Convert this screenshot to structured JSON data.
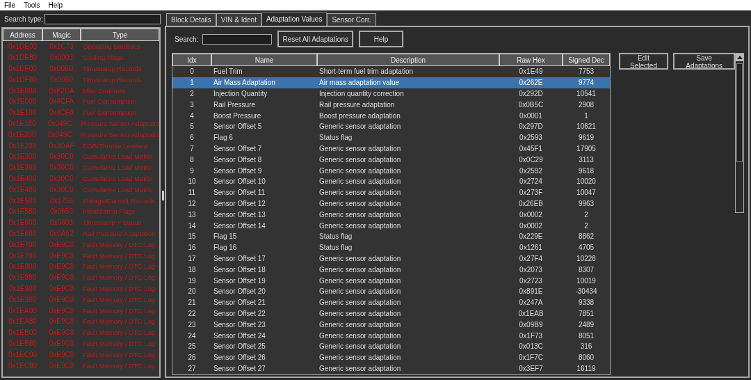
{
  "menu": [
    "File",
    "Tools",
    "Help"
  ],
  "search_type": {
    "label": "Search type:"
  },
  "blocks": {
    "columns": [
      "Address",
      "Magic",
      "Type"
    ],
    "rows": [
      {
        "address": "0x1DE00",
        "magic": "0x1C73",
        "type": "Operating Statistics"
      },
      {
        "address": "0x1DE80",
        "magic": "0x0003",
        "type": "Cooling Flags"
      },
      {
        "address": "0x1DF00",
        "magic": "0x006D",
        "type": "Timestamp Records"
      },
      {
        "address": "0x1DF80",
        "magic": "0x0060",
        "type": "Timestamp Records"
      },
      {
        "address": "0x1E000",
        "magic": "0xF2CA",
        "type": "Misc Counters"
      },
      {
        "address": "0x1E080",
        "magic": "0x4CFA",
        "type": "Fuel Consumption"
      },
      {
        "address": "0x1E100",
        "magic": "0x4CFA",
        "type": "Fuel Consumption"
      },
      {
        "address": "0x1E180",
        "magic": "0x049C",
        "type": "Pressure Sensor Adaptatio"
      },
      {
        "address": "0x1E200",
        "magic": "0x049C",
        "type": "Pressure Sensor Adaptatio"
      },
      {
        "address": "0x1E280",
        "magic": "0x3DAF",
        "type": "EGR/Throttle Learned"
      },
      {
        "address": "0x1E300",
        "magic": "0x30C0",
        "type": "Cumulative Load Matrix"
      },
      {
        "address": "0x1E380",
        "magic": "0x30C0",
        "type": "Cumulative Load Matrix"
      },
      {
        "address": "0x1E400",
        "magic": "0x30C0",
        "type": "Cumulative Load Matrix"
      },
      {
        "address": "0x1E480",
        "magic": "0x30C0",
        "type": "Cumulative Load Matrix"
      },
      {
        "address": "0x1E500",
        "magic": "0x1758",
        "type": "Voltage/Current Records"
      },
      {
        "address": "0x1E580",
        "magic": "0x0659",
        "type": "Initialization Flags"
      },
      {
        "address": "0x1E600",
        "magic": "0x0603",
        "type": "Timestamp + Status"
      },
      {
        "address": "0x1E680",
        "magic": "0x0A52",
        "type": "Rail Pressure Adaptation"
      },
      {
        "address": "0x1E700",
        "magic": "0xE9C8",
        "type": "Fault Memory / DTC Log"
      },
      {
        "address": "0x1E780",
        "magic": "0xE9C8",
        "type": "Fault Memory / DTC Log"
      },
      {
        "address": "0x1E800",
        "magic": "0xE9C8",
        "type": "Fault Memory / DTC Log"
      },
      {
        "address": "0x1E880",
        "magic": "0xE9C8",
        "type": "Fault Memory / DTC Log"
      },
      {
        "address": "0x1E900",
        "magic": "0xE9C8",
        "type": "Fault Memory / DTC Log"
      },
      {
        "address": "0x1E980",
        "magic": "0xE9C8",
        "type": "Fault Memory / DTC Log"
      },
      {
        "address": "0x1EA00",
        "magic": "0xE9C8",
        "type": "Fault Memory / DTC Log"
      },
      {
        "address": "0x1EA80",
        "magic": "0xE9C8",
        "type": "Fault Memory / DTC Log"
      },
      {
        "address": "0x1EB00",
        "magic": "0xE9C8",
        "type": "Fault Memory / DTC Log"
      },
      {
        "address": "0x1EB80",
        "magic": "0xE9C8",
        "type": "Fault Memory / DTC Log"
      },
      {
        "address": "0x1EC00",
        "magic": "0xE9C8",
        "type": "Fault Memory / DTC Log"
      },
      {
        "address": "0x1EC80",
        "magic": "0xE9C8",
        "type": "Fault Memory / DTC Log"
      }
    ]
  },
  "tabs": [
    {
      "label": "Block Details",
      "selected": false
    },
    {
      "label": "VIN & Ident",
      "selected": false
    },
    {
      "label": "Adaptation Values",
      "selected": true
    },
    {
      "label": "Sensor Corr.",
      "selected": false
    }
  ],
  "search": {
    "label": "Search:"
  },
  "toolbar_buttons": [
    "Reset All Adaptations",
    "Help"
  ],
  "side_buttons": [
    "Edit Selected",
    "Save Adaptations"
  ],
  "table": {
    "columns": [
      "Idx",
      "Name",
      "Description",
      "Raw Hex",
      "Signed Dec"
    ],
    "rows": [
      {
        "idx": "0",
        "name": "Fuel Trim",
        "description": "Short-term fuel trim adaptation",
        "raw_hex": "0x1E49",
        "signed_dec": "7753",
        "selected": false
      },
      {
        "idx": "1",
        "name": "Air Mass Adaptation",
        "description": "Air mass adaptation value",
        "raw_hex": "0x262E",
        "signed_dec": "9774",
        "selected": true
      },
      {
        "idx": "2",
        "name": "Injection Quantity",
        "description": "Injection quantity correction",
        "raw_hex": "0x292D",
        "signed_dec": "10541",
        "selected": false
      },
      {
        "idx": "3",
        "name": "Rail Pressure",
        "description": "Rail pressure adaptation",
        "raw_hex": "0x0B5C",
        "signed_dec": "2908",
        "selected": false
      },
      {
        "idx": "4",
        "name": "Boost Pressure",
        "description": "Boost pressure adaptation",
        "raw_hex": "0x0001",
        "signed_dec": "1",
        "selected": false
      },
      {
        "idx": "5",
        "name": "Sensor Offset 5",
        "description": "Generic sensor adaptation",
        "raw_hex": "0x297D",
        "signed_dec": "10621",
        "selected": false
      },
      {
        "idx": "6",
        "name": "Flag 6",
        "description": "Status flag",
        "raw_hex": "0x2593",
        "signed_dec": "9619",
        "selected": false
      },
      {
        "idx": "7",
        "name": "Sensor Offset 7",
        "description": "Generic sensor adaptation",
        "raw_hex": "0x45F1",
        "signed_dec": "17905",
        "selected": false
      },
      {
        "idx": "8",
        "name": "Sensor Offset 8",
        "description": "Generic sensor adaptation",
        "raw_hex": "0x0C29",
        "signed_dec": "3113",
        "selected": false
      },
      {
        "idx": "9",
        "name": "Sensor Offset 9",
        "description": "Generic sensor adaptation",
        "raw_hex": "0x2592",
        "signed_dec": "9618",
        "selected": false
      },
      {
        "idx": "10",
        "name": "Sensor Offset 10",
        "description": "Generic sensor adaptation",
        "raw_hex": "0x2724",
        "signed_dec": "10020",
        "selected": false
      },
      {
        "idx": "11",
        "name": "Sensor Offset 11",
        "description": "Generic sensor adaptation",
        "raw_hex": "0x273F",
        "signed_dec": "10047",
        "selected": false
      },
      {
        "idx": "12",
        "name": "Sensor Offset 12",
        "description": "Generic sensor adaptation",
        "raw_hex": "0x26EB",
        "signed_dec": "9963",
        "selected": false
      },
      {
        "idx": "13",
        "name": "Sensor Offset 13",
        "description": "Generic sensor adaptation",
        "raw_hex": "0x0002",
        "signed_dec": "2",
        "selected": false
      },
      {
        "idx": "14",
        "name": "Sensor Offset 14",
        "description": "Generic sensor adaptation",
        "raw_hex": "0x0002",
        "signed_dec": "2",
        "selected": false
      },
      {
        "idx": "15",
        "name": "Flag 15",
        "description": "Status flag",
        "raw_hex": "0x229E",
        "signed_dec": "8862",
        "selected": false
      },
      {
        "idx": "16",
        "name": "Flag 16",
        "description": "Status flag",
        "raw_hex": "0x1261",
        "signed_dec": "4705",
        "selected": false
      },
      {
        "idx": "17",
        "name": "Sensor Offset 17",
        "description": "Generic sensor adaptation",
        "raw_hex": "0x27F4",
        "signed_dec": "10228",
        "selected": false
      },
      {
        "idx": "18",
        "name": "Sensor Offset 18",
        "description": "Generic sensor adaptation",
        "raw_hex": "0x2073",
        "signed_dec": "8307",
        "selected": false
      },
      {
        "idx": "19",
        "name": "Sensor Offset 19",
        "description": "Generic sensor adaptation",
        "raw_hex": "0x2723",
        "signed_dec": "10019",
        "selected": false
      },
      {
        "idx": "20",
        "name": "Sensor Offset 20",
        "description": "Generic sensor adaptation",
        "raw_hex": "0x891E",
        "signed_dec": "-30434",
        "selected": false
      },
      {
        "idx": "21",
        "name": "Sensor Offset 21",
        "description": "Generic sensor adaptation",
        "raw_hex": "0x247A",
        "signed_dec": "9338",
        "selected": false
      },
      {
        "idx": "22",
        "name": "Sensor Offset 22",
        "description": "Generic sensor adaptation",
        "raw_hex": "0x1EAB",
        "signed_dec": "7851",
        "selected": false
      },
      {
        "idx": "23",
        "name": "Sensor Offset 23",
        "description": "Generic sensor adaptation",
        "raw_hex": "0x09B9",
        "signed_dec": "2489",
        "selected": false
      },
      {
        "idx": "24",
        "name": "Sensor Offset 24",
        "description": "Generic sensor adaptation",
        "raw_hex": "0x1F73",
        "signed_dec": "8051",
        "selected": false
      },
      {
        "idx": "25",
        "name": "Sensor Offset 25",
        "description": "Generic sensor adaptation",
        "raw_hex": "0x013C",
        "signed_dec": "316",
        "selected": false
      },
      {
        "idx": "26",
        "name": "Sensor Offset 26",
        "description": "Generic sensor adaptation",
        "raw_hex": "0x1F7C",
        "signed_dec": "8060",
        "selected": false
      },
      {
        "idx": "27",
        "name": "Sensor Offset 27",
        "description": "Generic sensor adaptation",
        "raw_hex": "0x3EF7",
        "signed_dec": "16119",
        "selected": false
      }
    ]
  }
}
